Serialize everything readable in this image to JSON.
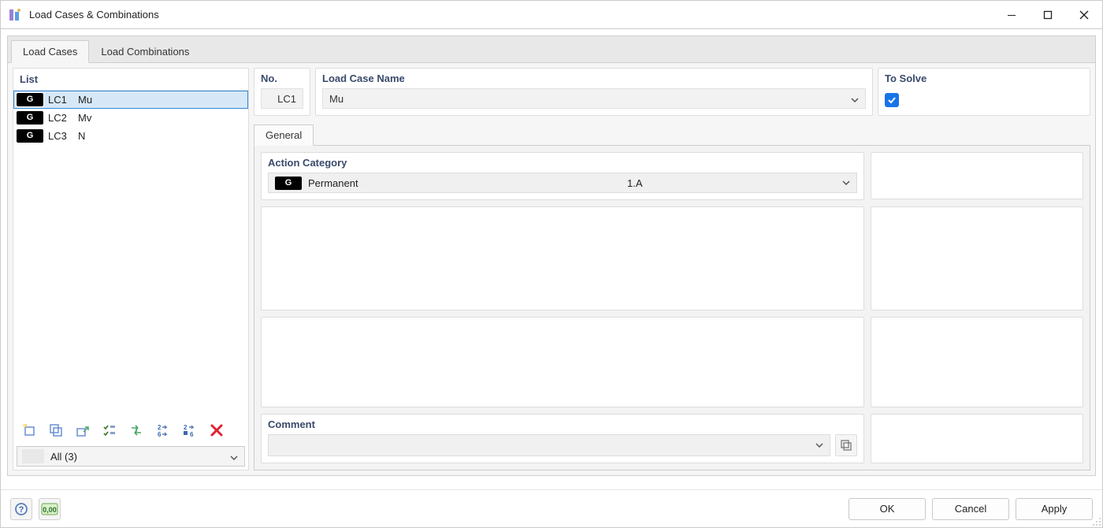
{
  "window": {
    "title": "Load Cases & Combinations"
  },
  "tabs": [
    {
      "label": "Load Cases"
    },
    {
      "label": "Load Combinations"
    }
  ],
  "list": {
    "header": "List",
    "items": [
      {
        "type": "G",
        "id": "LC1",
        "name": "Mu"
      },
      {
        "type": "G",
        "id": "LC2",
        "name": "Mv"
      },
      {
        "type": "G",
        "id": "LC3",
        "name": "N"
      }
    ],
    "filter": "All (3)"
  },
  "detail": {
    "no_header": "No.",
    "no_value": "LC1",
    "name_header": "Load Case Name",
    "name_value": "Mu",
    "solve_header": "To Solve",
    "solve_checked": true
  },
  "general_tab": "General",
  "action_category": {
    "header": "Action Category",
    "type": "G",
    "name": "Permanent",
    "code": "1.A"
  },
  "comment": {
    "header": "Comment",
    "value": ""
  },
  "footer": {
    "ok": "OK",
    "cancel": "Cancel",
    "apply": "Apply"
  },
  "icons": {
    "app": "app-icon",
    "new": "new-load-case",
    "copy": "copy-load-case",
    "attach": "attach-load-case",
    "check_all": "select-all",
    "swap": "swap",
    "renumber": "renumber",
    "renumber2": "renumber-range",
    "delete": "delete",
    "help": "help",
    "units": "units",
    "comment_copy": "copy-comment"
  }
}
